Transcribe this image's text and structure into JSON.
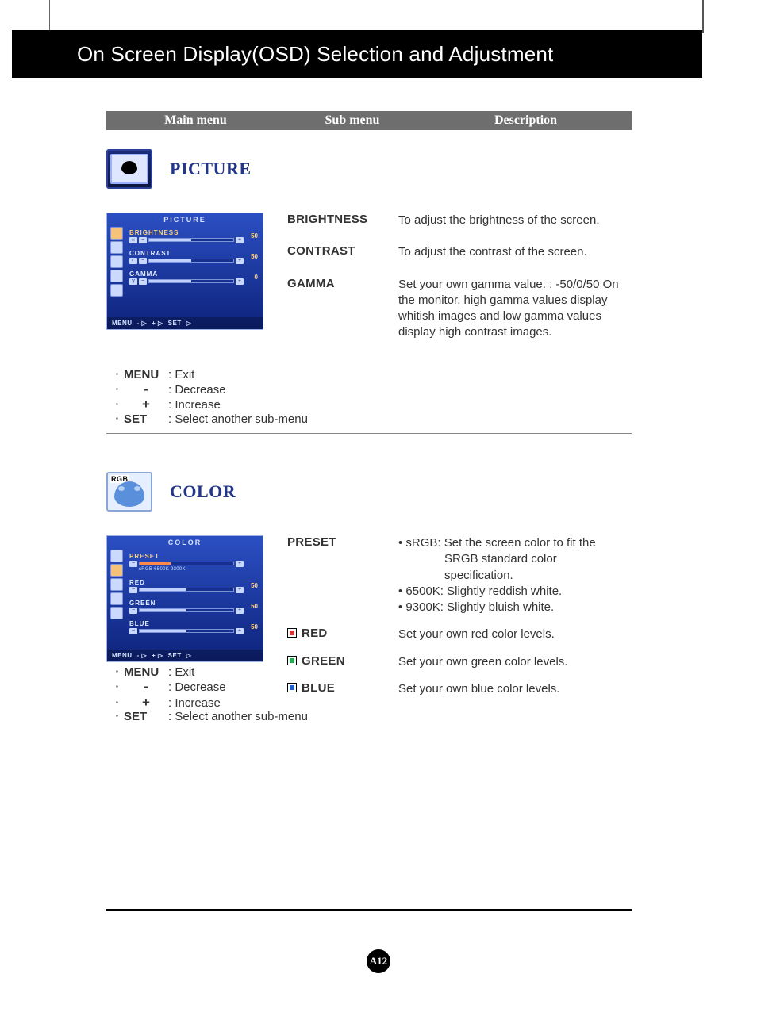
{
  "title": "On Screen Display(OSD) Selection and Adjustment",
  "header": {
    "main": "Main menu",
    "sub": "Sub menu",
    "desc": "Description"
  },
  "picture": {
    "heading": "PICTURE",
    "osd": {
      "title": "PICTURE",
      "brightness_label": "BRIGHTNESS",
      "brightness_val": "50",
      "contrast_label": "CONTRAST",
      "contrast_val": "50",
      "gamma_label": "GAMMA",
      "gamma_val": "0",
      "footer_menu": "MENU",
      "footer_set": "SET"
    },
    "subs": {
      "brightness": {
        "label": "BRIGHTNESS",
        "desc": "To adjust the brightness of the screen."
      },
      "contrast": {
        "label": "CONTRAST",
        "desc": "To adjust the contrast of the screen."
      },
      "gamma": {
        "label": "GAMMA",
        "desc": "Set your own gamma value. : -50/0/50 On the monitor, high gamma values display whitish images and low gamma values display high contrast images."
      }
    },
    "legend": {
      "menu": "MENU",
      "menu_desc": ": Exit",
      "minus": "-",
      "minus_desc": ": Decrease",
      "plus": "+",
      "plus_desc": ": Increase",
      "set": "SET",
      "set_desc": ": Select another sub-menu"
    }
  },
  "color": {
    "heading": "COLOR",
    "rgb_tag": "RGB",
    "osd": {
      "title": "COLOR",
      "preset_label": "PRESET",
      "preset_marks": "sRGB 6500K     9300K",
      "red_label": "RED",
      "red_val": "50",
      "green_label": "GREEN",
      "green_val": "50",
      "blue_label": "BLUE",
      "blue_val": "50",
      "footer_menu": "MENU",
      "footer_set": "SET"
    },
    "subs": {
      "preset": {
        "label": "PRESET",
        "l1": "• sRGB: Set the screen color to fit the",
        "l1b": "SRGB standard color",
        "l1c": "specification.",
        "l2": "• 6500K: Slightly reddish white.",
        "l3": "• 9300K: Slightly bluish white."
      },
      "red": {
        "label": "RED",
        "desc": "Set your own red color levels."
      },
      "green": {
        "label": "GREEN",
        "desc": "Set your own green color levels."
      },
      "blue": {
        "label": "BLUE",
        "desc": "Set your own blue color levels."
      }
    },
    "legend": {
      "menu": "MENU",
      "menu_desc": ": Exit",
      "minus": "-",
      "minus_desc": ": Decrease",
      "plus": "+",
      "plus_desc": ": Increase",
      "set": "SET",
      "set_desc": ": Select another sub-menu"
    }
  },
  "page_number": "A12"
}
